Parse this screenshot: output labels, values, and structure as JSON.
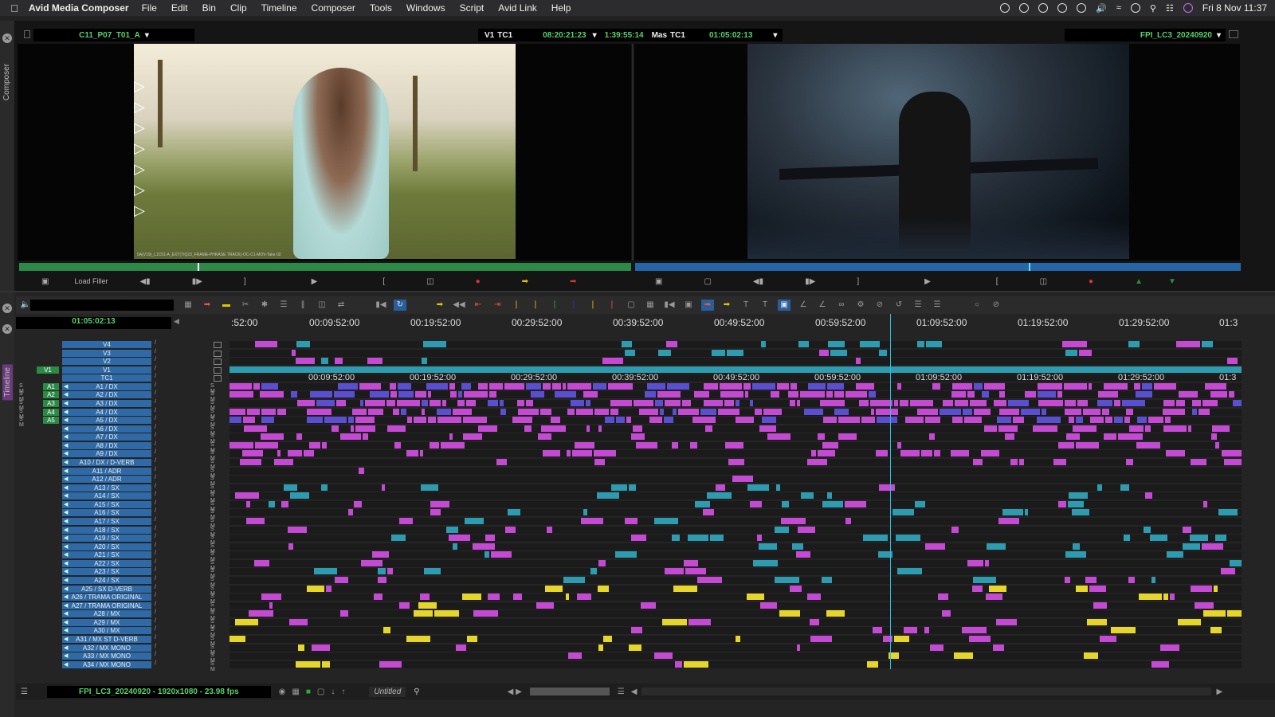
{
  "menubar": {
    "app_name": "Avid Media Composer",
    "items": [
      "File",
      "Edit",
      "Bin",
      "Clip",
      "Timeline",
      "Composer",
      "Tools",
      "Windows",
      "Script",
      "Avid Link",
      "Help"
    ],
    "datetime": "Fri 8 Nov  11:37"
  },
  "composer": {
    "side_label": "Composer",
    "source_clip": "C11_P07_T01_A",
    "v1_label": "V1",
    "tc1_label": "TC1",
    "tc_source": "08:20:21:23",
    "duration": "1:39:55:14",
    "mas_label": "Mas",
    "mas_tc_label": "TC1",
    "tc_master": "01:05:02:13",
    "record_sequence": "FPI_LC3_20240920",
    "load_filler": "Load Filler",
    "source_burnin": "5A(V19)_L1C51-A_EXT(TIQ23_FRAME-PHRASE TRACK)-OC-C1-MOV-Take 02"
  },
  "timeline": {
    "side_label": "Timeline",
    "timecode": "01:05:02:13",
    "ruler": [
      ":52:00",
      "00:09:52:00",
      "00:19:52:00",
      "00:29:52:00",
      "00:39:52:00",
      "00:49:52:00",
      "00:59:52:00",
      "01:09:52:00",
      "01:19:52:00",
      "01:29:52:00",
      "01:3"
    ],
    "ruler2": [
      "00:09:52:00",
      "00:19:52:00",
      "00:29:52:00",
      "00:39:52:00",
      "00:49:52:00",
      "00:59:52:00",
      "01:09:52:00",
      "01:19:52:00",
      "01:29:52:00",
      "01:3"
    ],
    "video_tracks": [
      "V4",
      "V3",
      "V2",
      "V1",
      "TC1"
    ],
    "source_v_track": "V1",
    "source_a_tracks": [
      "A1",
      "A2",
      "A3",
      "A4",
      "A5"
    ],
    "audio_tracks": [
      "A1 / DX",
      "A2 / DX",
      "A3 / DX",
      "A4 / DX",
      "A5 / DX",
      "A6 / DX",
      "A7 / DX",
      "A8 / DX",
      "A9 / DX",
      "A10 / DX / D-VERB",
      "A11 / ADR",
      "A12 / ADR",
      "A13 / SX",
      "A14 / SX",
      "A15 / SX",
      "A16 / SX",
      "A17 / SX",
      "A18 / SX",
      "A19 / SX",
      "A20 / SX",
      "A21 / SX",
      "A22 / SX",
      "A23 / SX",
      "A24 / SX",
      "A25 / SX D-VERB",
      "A26 / TRAMA ORIGINAL",
      "A27 / TRAMA ORIGINAL",
      "A28 / MX",
      "A29 / MX",
      "A30 / MX",
      "A31 / MX ST D-VERB",
      "A32 / MX MONO",
      "A33 / MX MONO",
      "A34 / MX MONO"
    ]
  },
  "statusbar": {
    "sequence_info": "FPI_LC3_20240920 - 1920x1080 - 23.98 fps",
    "bin_name": "Untitled"
  },
  "colors": {
    "accent_blue": "#2f6aa6",
    "timecode_green": "#57d36a",
    "clip_purple": "#c44ad4",
    "clip_cyan": "#2e9cb0",
    "clip_yellow": "#e6d52a",
    "playhead": "#25c1e6"
  }
}
